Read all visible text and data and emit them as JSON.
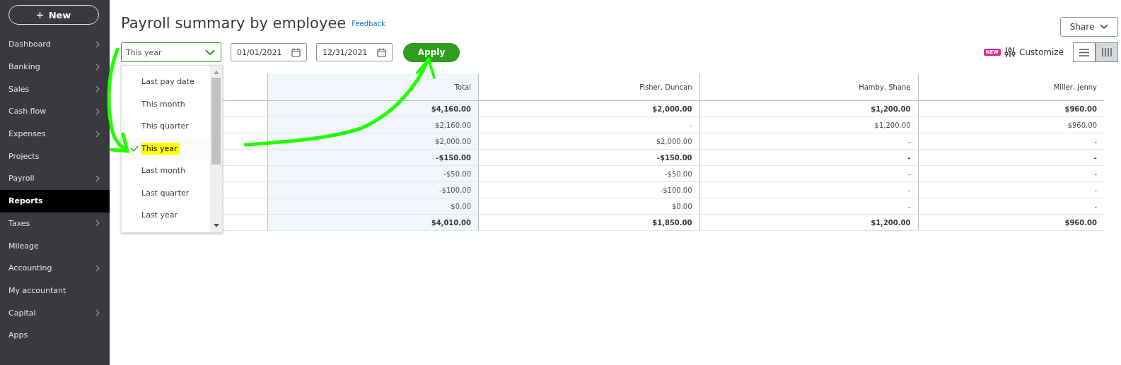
{
  "sidebar": {
    "new_button": "New",
    "items": [
      {
        "label": "Dashboard",
        "selected": false,
        "submenu": true
      },
      {
        "label": "Banking",
        "selected": false,
        "submenu": true
      },
      {
        "label": "Sales",
        "selected": false,
        "submenu": true
      },
      {
        "label": "Cash flow",
        "selected": false,
        "submenu": true
      },
      {
        "label": "Expenses",
        "selected": false,
        "submenu": true
      },
      {
        "label": "Projects",
        "selected": false,
        "submenu": false
      },
      {
        "label": "Payroll",
        "selected": false,
        "submenu": true
      },
      {
        "label": "Reports",
        "selected": true,
        "submenu": false
      },
      {
        "label": "Taxes",
        "selected": false,
        "submenu": true
      },
      {
        "label": "Mileage",
        "selected": false,
        "submenu": false
      },
      {
        "label": "Accounting",
        "selected": false,
        "submenu": true
      },
      {
        "label": "My accountant",
        "selected": false,
        "submenu": false
      },
      {
        "label": "Capital",
        "selected": false,
        "submenu": true
      },
      {
        "label": "Apps",
        "selected": false,
        "submenu": false
      }
    ]
  },
  "title": "Payroll summary by employee",
  "feedback_link": "Feedback",
  "share_button": "Share",
  "period_select": {
    "value": "This year",
    "expanded": true,
    "options": [
      {
        "label": "Last pay date",
        "selected": false
      },
      {
        "label": "This month",
        "selected": false
      },
      {
        "label": "This quarter",
        "selected": false
      },
      {
        "label": "This year",
        "selected": true
      },
      {
        "label": "Last month",
        "selected": false
      },
      {
        "label": "Last quarter",
        "selected": false
      },
      {
        "label": "Last year",
        "selected": false
      }
    ]
  },
  "start_date": "01/01/2021",
  "end_date": "12/31/2021",
  "apply_button": "Apply",
  "new_badge": "NEW",
  "customize_button": "Customize",
  "view_toggle": [
    {
      "kind": "rows",
      "selected": false
    },
    {
      "kind": "columns",
      "selected": true
    }
  ],
  "table": {
    "columns": [
      "Total",
      "Fisher, Duncan",
      "Hamby, Shane",
      "Miller, Jenny"
    ],
    "rows": [
      {
        "bold": true,
        "cells": [
          "$4,160.00",
          "$2,000.00",
          "$1,200.00",
          "$960.00"
        ]
      },
      {
        "bold": false,
        "cells": [
          "$2,160.00",
          "-",
          "$1,200.00",
          "$960.00"
        ]
      },
      {
        "bold": false,
        "cells": [
          "$2,000.00",
          "$2,000.00",
          "-",
          "-"
        ]
      },
      {
        "bold": true,
        "cells": [
          "-$150.00",
          "-$150.00",
          "-",
          "-"
        ]
      },
      {
        "bold": false,
        "cells": [
          "-$50.00",
          "-$50.00",
          "-",
          "-"
        ]
      },
      {
        "bold": false,
        "cells": [
          "-$100.00",
          "-$100.00",
          "-",
          "-"
        ]
      },
      {
        "bold": false,
        "cells": [
          "$0.00",
          "$0.00",
          "-",
          "-"
        ]
      },
      {
        "bold": true,
        "cells": [
          "$4,010.00",
          "$1,850.00",
          "$1,200.00",
          "$960.00"
        ]
      }
    ]
  }
}
